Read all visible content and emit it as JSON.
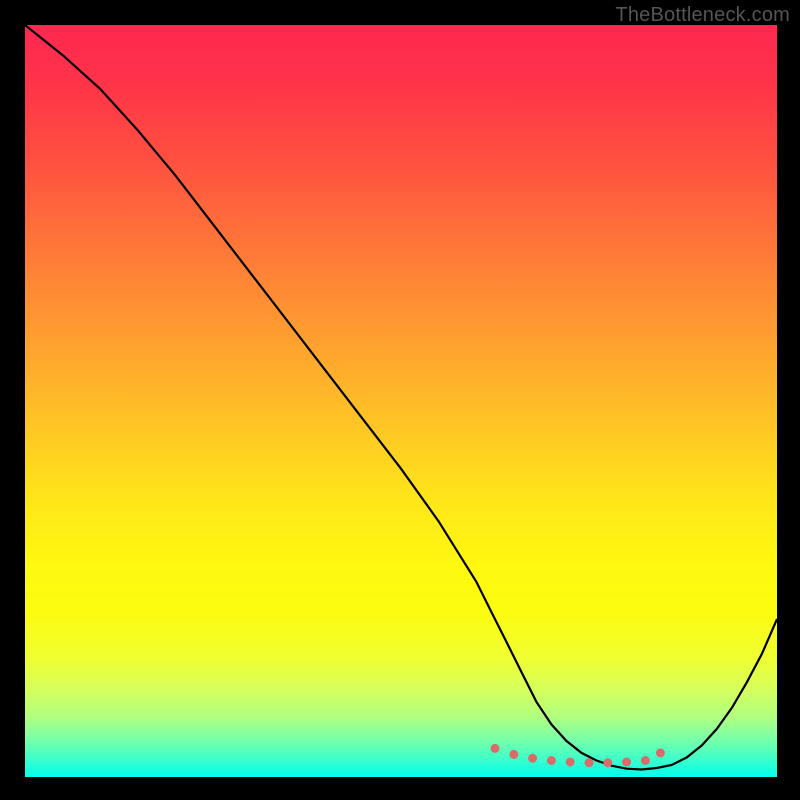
{
  "watermark": "TheBottleneck.com",
  "chart_data": {
    "type": "line",
    "title": "",
    "xlabel": "",
    "ylabel": "",
    "xlim": [
      0,
      100
    ],
    "ylim": [
      0,
      100
    ],
    "series": [
      {
        "name": "bottleneck-curve",
        "x": [
          0,
          5,
          10,
          15,
          20,
          25,
          30,
          35,
          40,
          45,
          50,
          55,
          60,
          62,
          64,
          66,
          68,
          70,
          72,
          74,
          76,
          78,
          80,
          82,
          84,
          86,
          88,
          90,
          92,
          94,
          96,
          98,
          100
        ],
        "values": [
          100,
          96,
          91.5,
          86,
          80,
          73.5,
          67,
          60.5,
          54,
          47.5,
          41,
          34,
          26,
          22,
          18,
          14,
          10,
          7,
          4.8,
          3.2,
          2.2,
          1.5,
          1.1,
          1,
          1.2,
          1.6,
          2.6,
          4.2,
          6.4,
          9.2,
          12.6,
          16.4,
          21
        ]
      }
    ],
    "marker_points": {
      "x": [
        62.5,
        65,
        67.5,
        70,
        72.5,
        75,
        77.5,
        80,
        82.5,
        84.5
      ],
      "values": [
        3.8,
        3.0,
        2.5,
        2.2,
        2.0,
        1.9,
        1.9,
        2.0,
        2.2,
        3.2
      ]
    },
    "colors": {
      "curve": "#000000",
      "markers": "#d96b6b",
      "gradient_top": "#ff2850",
      "gradient_bottom": "#08fff0"
    }
  }
}
